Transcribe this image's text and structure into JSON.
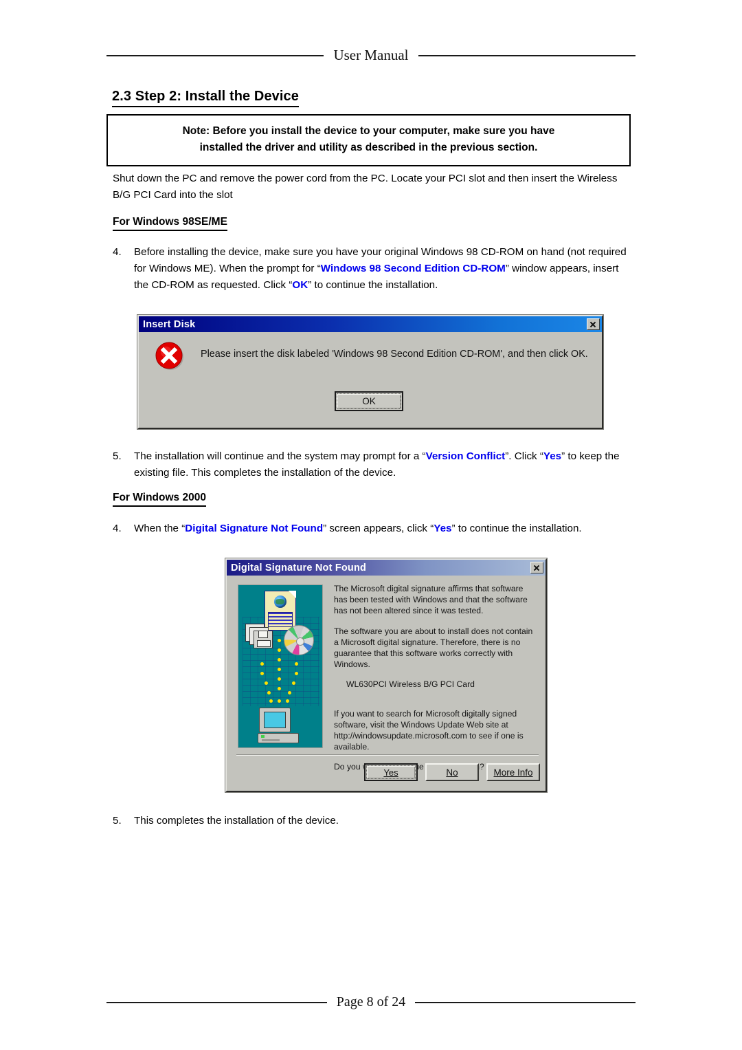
{
  "header": {
    "label": "User Manual"
  },
  "footer": {
    "label": "Page 8 of 24"
  },
  "section": {
    "heading": "2.3 Step 2: Install the Device"
  },
  "note": {
    "line1": "Note: Before you install the device to your computer, make sure you have",
    "line2": "installed the driver and utility as described in the previous section."
  },
  "intro": {
    "text": "Shut down the PC and remove the power cord from the PC. Locate your PCI slot and then insert the Wireless B/G PCI Card into the slot"
  },
  "sections": {
    "win98se_heading": "For Windows 98SE/ME",
    "win2000_heading": "For Windows 2000"
  },
  "steps": {
    "s98_4": {
      "number": "4.",
      "part1": "Before installing the device, make sure you have your original Windows 98 CD-ROM on hand (not required for Windows ME). When the prompt for “",
      "hl1": "Windows 98 Second Edition CD-ROM",
      "part2": "” window appears, insert the CD-ROM as requested. Click “",
      "hl2": "OK",
      "part3": "” to continue the installation."
    },
    "s98_5": {
      "number": "5.",
      "part1": "The installation will continue and the system may prompt for a “",
      "hl1": "Version Conflict",
      "part2": "”. Click “",
      "hl2": "Yes",
      "part3": "” to keep the existing file. This completes the installation of the device."
    },
    "s2k_4": {
      "number": "4.",
      "part1": "When the “",
      "hl1": "Digital Signature Not Found",
      "part2": "” screen appears, click “",
      "hl2": "Yes",
      "part3": "” to continue the installation."
    },
    "s2k_5": {
      "number": "5.",
      "text": "This completes the installation of the device."
    }
  },
  "dialog_insert_disk": {
    "title": "Insert Disk",
    "message": "Please insert the disk labeled 'Windows 98 Second Edition CD-ROM', and then click OK.",
    "ok_label": "OK",
    "icon": "error-icon",
    "close_label": "Close"
  },
  "dialog_digital_signature": {
    "title": "Digital Signature Not Found",
    "paragraph1": "The Microsoft digital signature affirms that software has been tested with Windows and that the software has not been altered since it was tested.",
    "paragraph2": "The software you are about to install does not contain a Microsoft digital signature. Therefore,  there is no guarantee that this software works correctly with Windows.",
    "device_name": "WL630PCI Wireless B/G PCI Card",
    "paragraph3": "If you want to search for Microsoft digitally signed software, visit the Windows Update Web site at http://windowsupdate.microsoft.com to see if one is available.",
    "question": "Do you want to continue the installation?",
    "buttons": {
      "yes": "Yes",
      "no": "No",
      "more_info": "More Info"
    },
    "close_label": "Close"
  },
  "colors": {
    "highlight": "#0000EE",
    "dialog_face": "#c3c3bd",
    "titlebar_start": "#00007d",
    "titlebar_end": "#1b86e6",
    "illustration_teal": "#00808a",
    "error_red": "#e00000",
    "dot_yellow": "#ffe000"
  }
}
